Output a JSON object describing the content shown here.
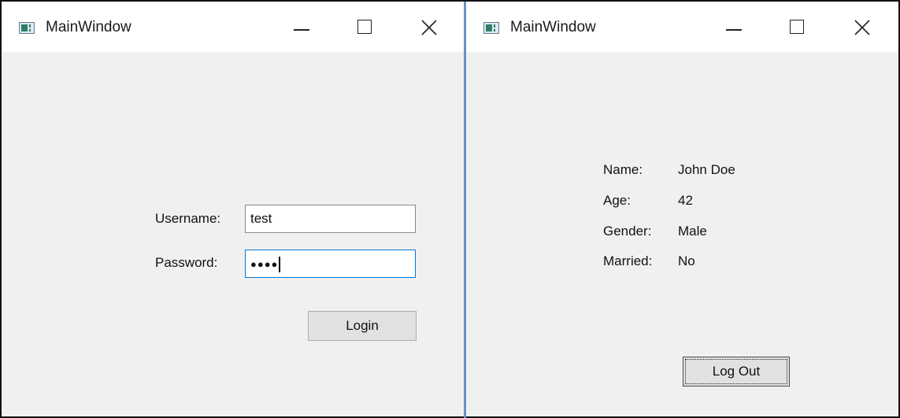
{
  "windows": {
    "login": {
      "title": "MainWindow",
      "username_label": "Username:",
      "username_value": "test",
      "password_label": "Password:",
      "password_masked": "●●●●",
      "login_button": "Login"
    },
    "profile": {
      "title": "MainWindow",
      "fields": [
        {
          "label": "Name:",
          "value": "John Doe"
        },
        {
          "label": "Age:",
          "value": "42"
        },
        {
          "label": "Gender:",
          "value": "Male"
        },
        {
          "label": "Married:",
          "value": "No"
        }
      ],
      "logout_button": "Log Out"
    }
  },
  "titlebar_icons": [
    "app-icon",
    "minimize-icon",
    "maximize-icon",
    "close-icon"
  ],
  "colors": {
    "focus_border": "#0078d7",
    "divider": "#6b93c3",
    "client_bg": "#f0f0f0"
  }
}
